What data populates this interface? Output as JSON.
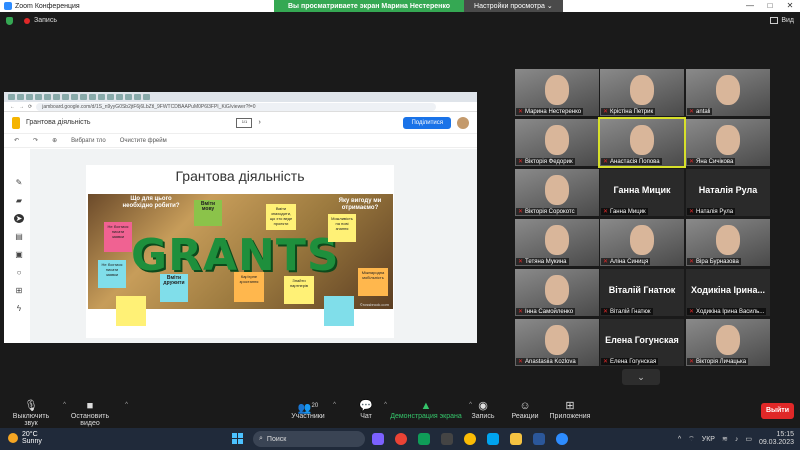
{
  "window": {
    "title": "Zoom Конференция",
    "minimize": "—",
    "maximize": "□",
    "close": "✕"
  },
  "banner": {
    "message": "Вы просматриваете экран Марина Нестеренко",
    "options": "Настройки просмотра"
  },
  "topbar": {
    "record": "Запись",
    "view": "Вид"
  },
  "browser": {
    "url": "jamboard.google.com/d/1S_n9yyG0Sb2jtF6j6LbZtl_9FWTCDBAAPuM0P6l3FPI_KiG/viewer?f=0"
  },
  "jamboard": {
    "title": "Грантова діяльність",
    "share_label": "Поділитися",
    "tools": {
      "undo": "↶",
      "redo": "↷",
      "zoom": "⊕",
      "set_bg": "Вибрати тло",
      "clear_frame": "Очистите фрейм"
    },
    "frame_title": "Грантова діяльність",
    "image": {
      "word": "GRANTS",
      "q1": "Що для цього необхідно робити?",
      "q2": "Вміти мову",
      "q3": "Яку вигоду ми отримаємо?",
      "note_not_afraid": "Не бохтися писати заявки",
      "note_be_friends": "Вміти дружити",
      "note_be_able": "Вміти знаходити, що хто веде проекти",
      "note_sponsorship": "Знайти партнерів",
      "note_career": "Кар'єрне зростання",
      "note_knowledge": "Можливість на нові знання",
      "note_international": "Міжнародна мобільність",
      "credit": "©rossbrook.com"
    },
    "colors": {
      "pink": "#f06292",
      "yellow": "#fff176",
      "green": "#8bc34a",
      "cyan": "#80deea",
      "orange": "#ffb74d"
    }
  },
  "participants": [
    {
      "name": "Марина Нестеренко",
      "type": "video"
    },
    {
      "name": "Крістіна Петрик",
      "type": "video"
    },
    {
      "name": "antali",
      "type": "video"
    },
    {
      "name": "Вікторія Федорик",
      "type": "video"
    },
    {
      "name": "Анастасія Попова",
      "type": "video",
      "speaking": true
    },
    {
      "name": "Яна Сичікова",
      "type": "video"
    },
    {
      "name": "Вікторія Сорокотс",
      "type": "video"
    },
    {
      "name": "Ганна Мицик",
      "type": "name",
      "big": "Ганна Мицик"
    },
    {
      "name": "Наталія Рула",
      "type": "name",
      "big": "Наталія Рула"
    },
    {
      "name": "Тетяна Мукина",
      "type": "video"
    },
    {
      "name": "Аліна Синиця",
      "type": "video"
    },
    {
      "name": "Віра Бурназова",
      "type": "video"
    },
    {
      "name": "Інна Самойленко",
      "type": "video"
    },
    {
      "name": "Віталій Гнатюк",
      "type": "name",
      "big": "Віталій Гнатюк"
    },
    {
      "name": "Ходикіна Ірина Василь...",
      "type": "name",
      "big": "Ходикіна Ірина..."
    },
    {
      "name": "Anastasiia Kozlova",
      "type": "video"
    },
    {
      "name": "Елена Гогунская",
      "type": "name",
      "big": "Елена Гогунская"
    },
    {
      "name": "Вікторія Личацька",
      "type": "video"
    }
  ],
  "toolbar": {
    "mute": "Выключить звук",
    "stop_video": "Остановить видео",
    "participants": "Участники",
    "participants_count": "20",
    "chat": "Чат",
    "share": "Демонстрация экрана",
    "record": "Запись",
    "reactions": "Реакции",
    "apps": "Приложения",
    "exit": "Выйти"
  },
  "taskbar": {
    "temp": "20°C",
    "weather": "Sunny",
    "search": "Поиск",
    "lang": "УКР",
    "time": "15:15",
    "date": "09.03.2023"
  }
}
